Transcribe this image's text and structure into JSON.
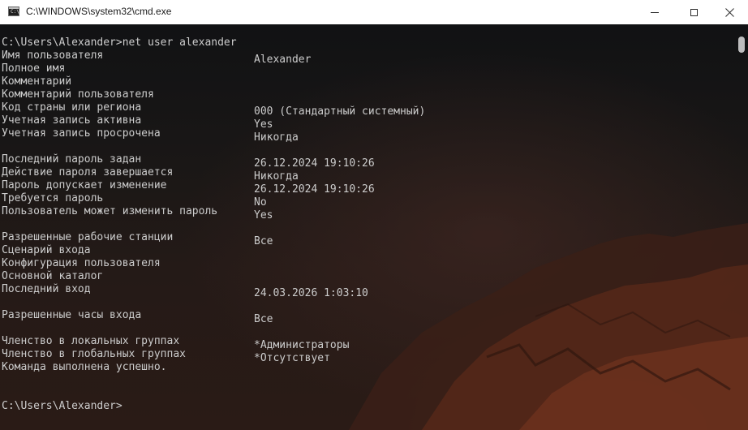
{
  "window": {
    "title": "C:\\WINDOWS\\system32\\cmd.exe",
    "icon_glyph": "C:\\"
  },
  "terminal": {
    "lines": [
      {
        "type": "cmd",
        "text": "C:\\Users\\Alexander>net user alexander"
      },
      {
        "type": "kv",
        "label": "Имя пользователя",
        "value": "Alexander"
      },
      {
        "type": "kv",
        "label": "Полное имя",
        "value": ""
      },
      {
        "type": "kv",
        "label": "Комментарий",
        "value": ""
      },
      {
        "type": "kv",
        "label": "Комментарий пользователя",
        "value": ""
      },
      {
        "type": "kv",
        "label": "Код страны или региона",
        "value": "000 (Стандартный системный)"
      },
      {
        "type": "kv",
        "label": "Учетная запись активна",
        "value": "Yes"
      },
      {
        "type": "kv",
        "label": "Учетная запись просрочена",
        "value": "Никогда"
      },
      {
        "type": "blank"
      },
      {
        "type": "kv",
        "label": "Последний пароль задан",
        "value": "26.12.2024 19:10:26"
      },
      {
        "type": "kv",
        "label": "Действие пароля завершается",
        "value": "Никогда"
      },
      {
        "type": "kv",
        "label": "Пароль допускает изменение",
        "value": "26.12.2024 19:10:26"
      },
      {
        "type": "kv",
        "label": "Требуется пароль",
        "value": "No"
      },
      {
        "type": "kv",
        "label": "Пользователь может изменить пароль",
        "value": "Yes"
      },
      {
        "type": "blank"
      },
      {
        "type": "kv",
        "label": "Разрешенные рабочие станции",
        "value": "Все"
      },
      {
        "type": "kv",
        "label": "Сценарий входа",
        "value": ""
      },
      {
        "type": "kv",
        "label": "Конфигурация пользователя",
        "value": ""
      },
      {
        "type": "kv",
        "label": "Основной каталог",
        "value": ""
      },
      {
        "type": "kv",
        "label": "Последний вход",
        "value": "24.03.2026 1:03:10"
      },
      {
        "type": "blank"
      },
      {
        "type": "kv",
        "label": "Разрешенные часы входа",
        "value": "Все"
      },
      {
        "type": "blank"
      },
      {
        "type": "kv",
        "label": "Членство в локальных группах",
        "value": "*Администраторы"
      },
      {
        "type": "kv",
        "label": "Членство в глобальных группах",
        "value": "*Отсутствует"
      },
      {
        "type": "text",
        "text": "Команда выполнена успешно."
      },
      {
        "type": "blank"
      },
      {
        "type": "blank"
      },
      {
        "type": "cmd",
        "text": "C:\\Users\\Alexander>"
      }
    ]
  },
  "icons": {
    "app": "console-app-icon",
    "minimize": "minimize-icon",
    "maximize": "maximize-icon",
    "close": "close-icon"
  }
}
